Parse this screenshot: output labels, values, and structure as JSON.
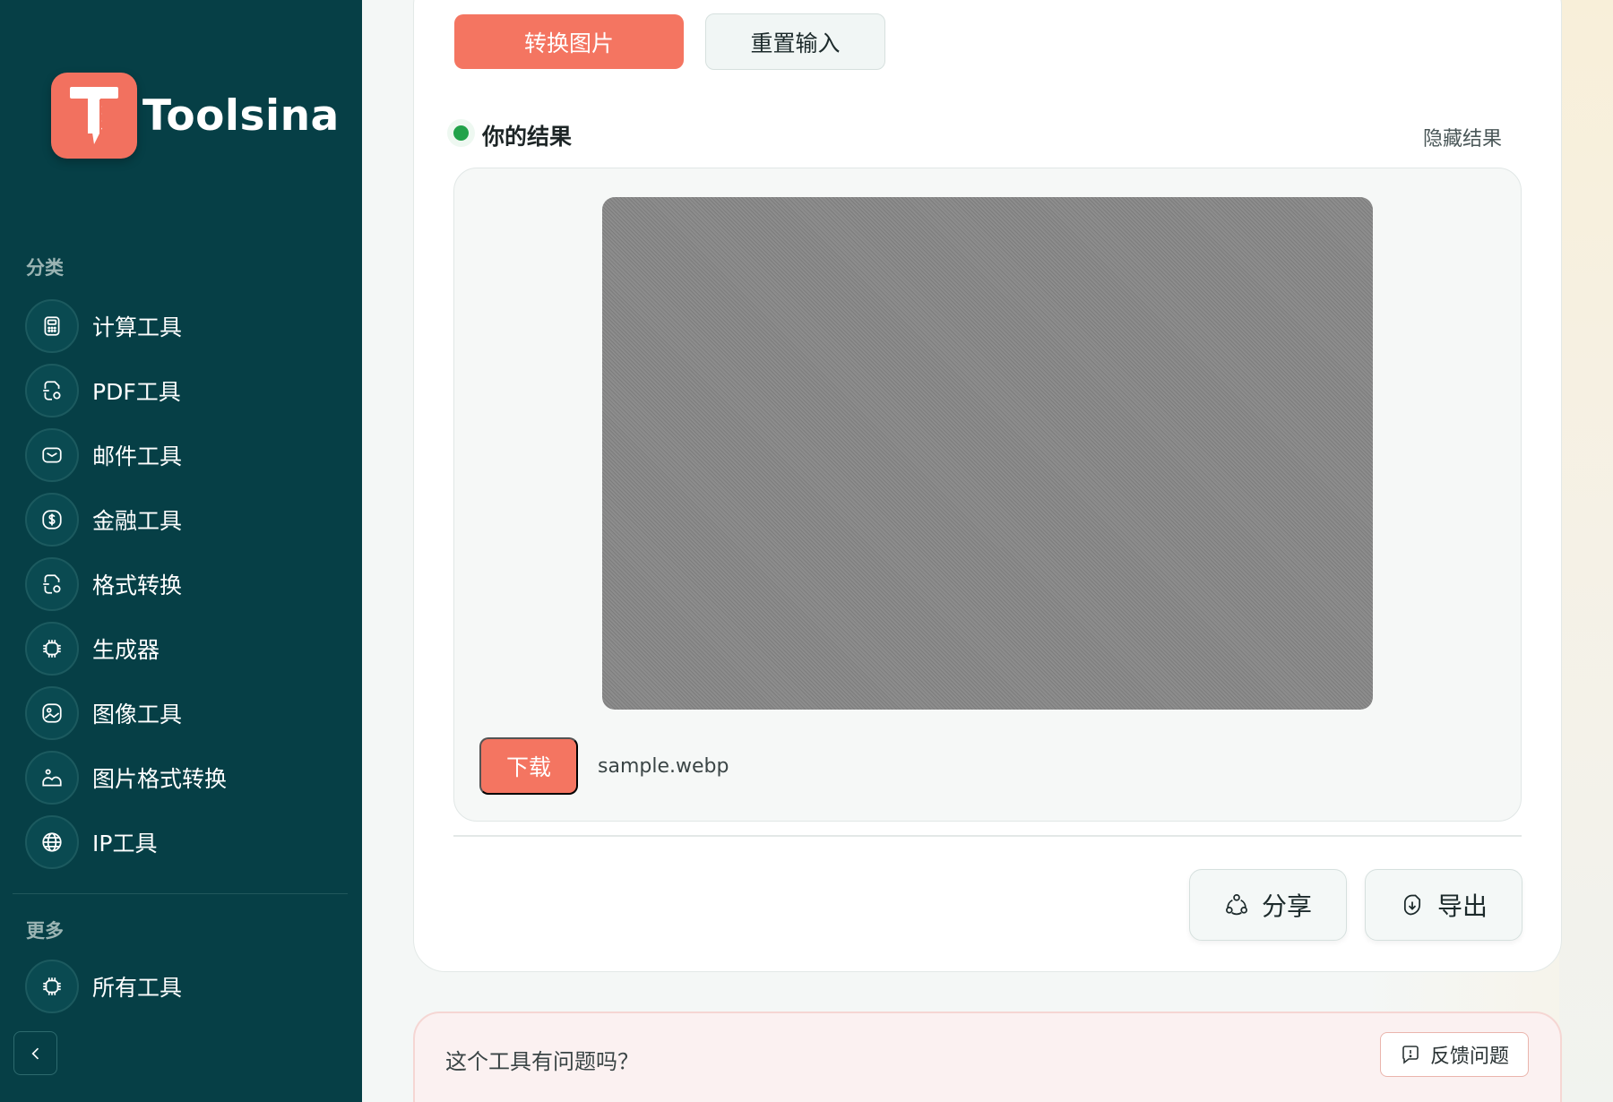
{
  "brand": {
    "name": "Toolsina",
    "accent": "#f47561",
    "sidebar_bg": "#063f46"
  },
  "sidebar": {
    "categories_title": "分类",
    "items": [
      {
        "label": "计算工具",
        "icon": "calculator-icon"
      },
      {
        "label": "PDF工具",
        "icon": "document-icon"
      },
      {
        "label": "邮件工具",
        "icon": "mail-icon"
      },
      {
        "label": "金融工具",
        "icon": "dollar-icon"
      },
      {
        "label": "格式转换",
        "icon": "file-convert-icon"
      },
      {
        "label": "生成器",
        "icon": "chip-icon"
      },
      {
        "label": "图像工具",
        "icon": "image-icon"
      },
      {
        "label": "图片格式转换",
        "icon": "image-convert-icon"
      },
      {
        "label": "IP工具",
        "icon": "globe-icon"
      }
    ],
    "more_title": "更多",
    "more_items": [
      {
        "label": "所有工具",
        "icon": "chip-icon"
      }
    ],
    "collapse_icon": "chevron-left-icon"
  },
  "actions": {
    "convert_label": "转换图片",
    "reset_label": "重置输入"
  },
  "result": {
    "title": "你的结果",
    "hide_label": "隐藏结果",
    "download_label": "下载",
    "filename": "sample.webp",
    "status_color": "#22a24a"
  },
  "footer_actions": {
    "share_label": "分享",
    "export_label": "导出"
  },
  "feedback": {
    "question": "这个工具有问题吗？",
    "button_label": "反馈问题"
  }
}
